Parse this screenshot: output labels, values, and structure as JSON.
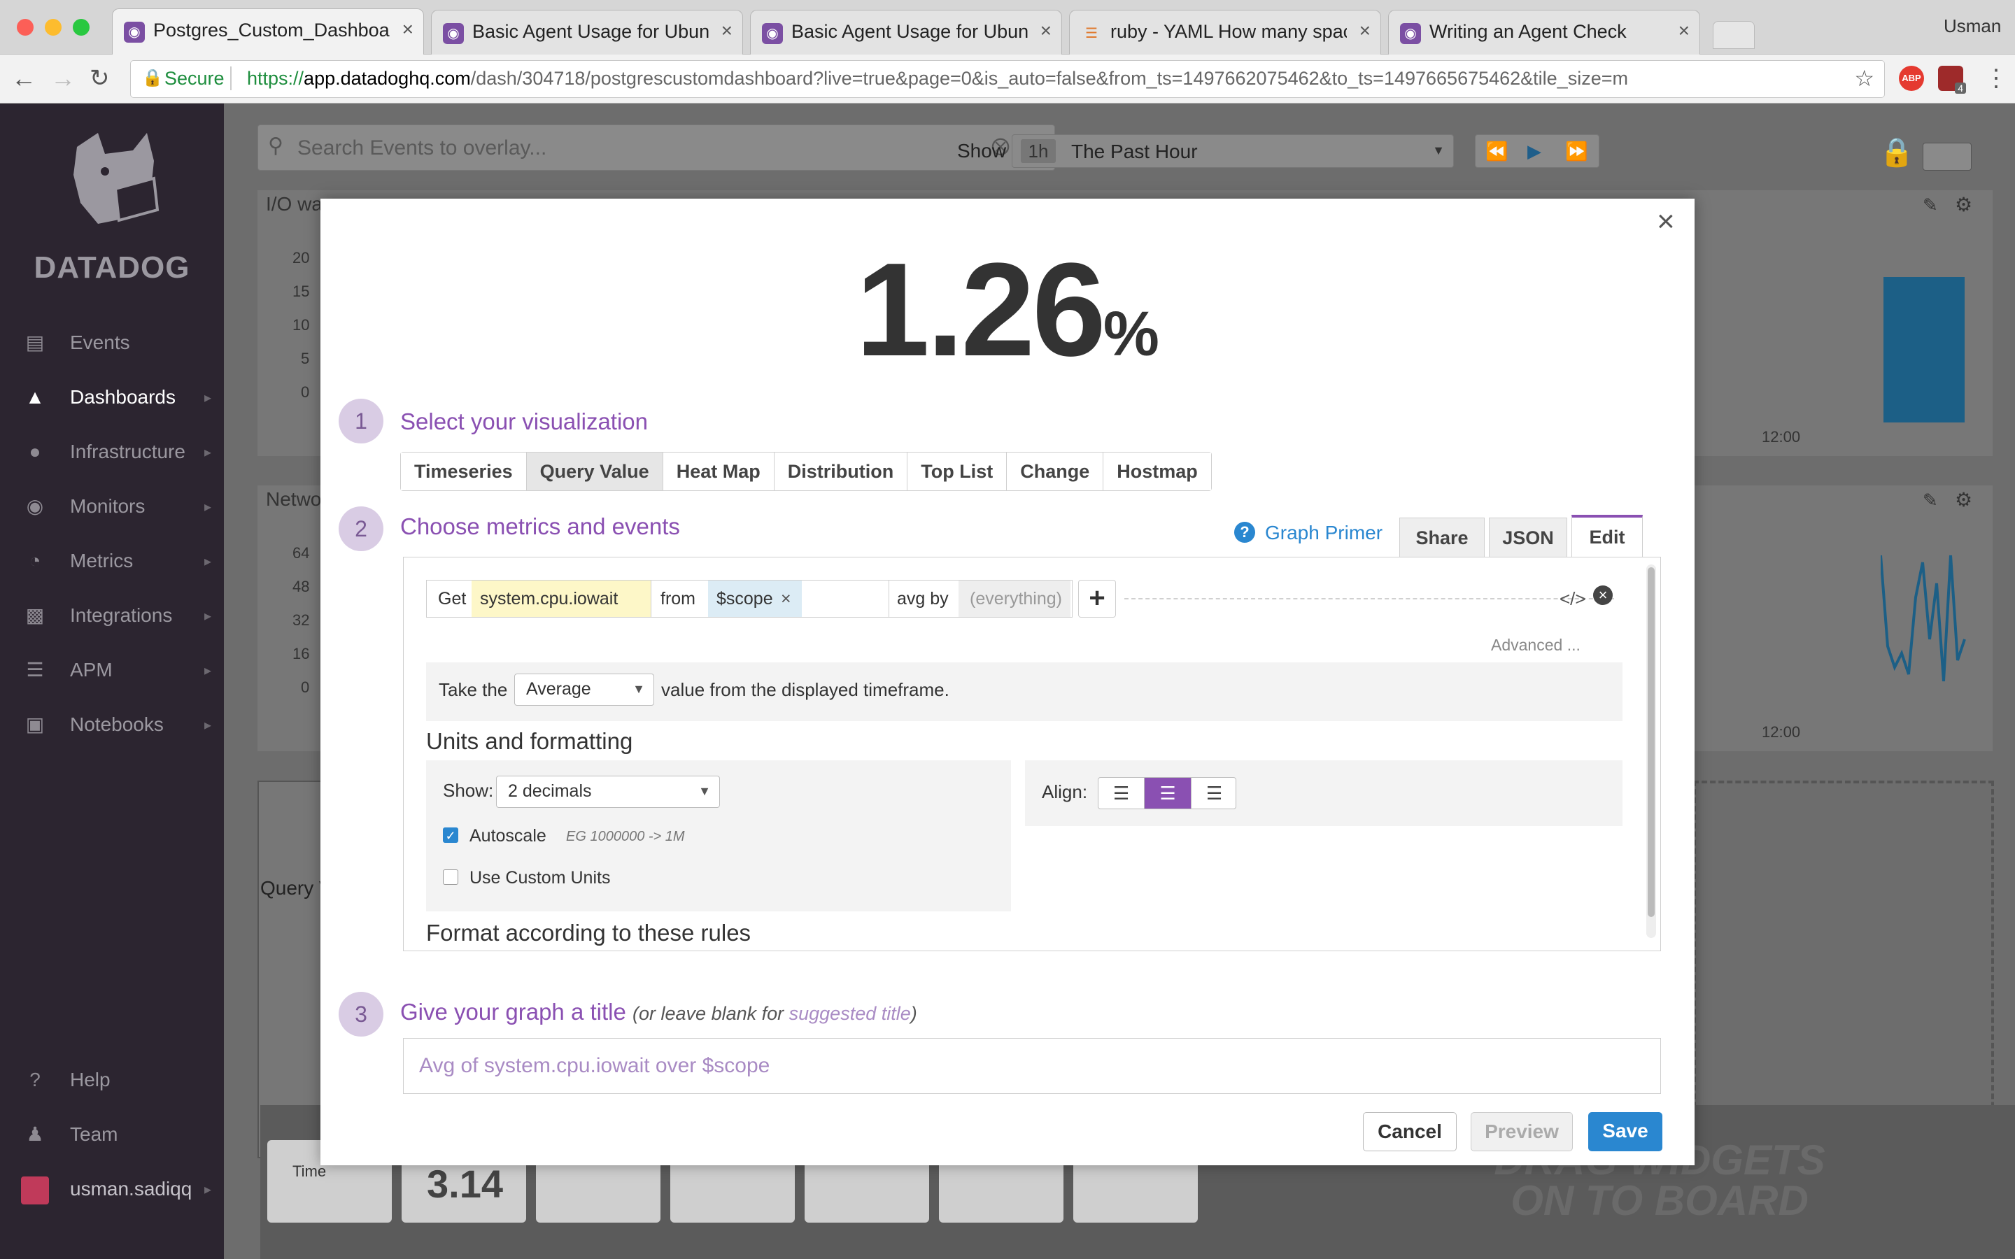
{
  "browser": {
    "tabs": [
      {
        "title": "Postgres_Custom_Dashboard | Da",
        "icon": "datadog-favicon"
      },
      {
        "title": "Basic Agent Usage for Ubuntu",
        "icon": "datadog-favicon"
      },
      {
        "title": "Basic Agent Usage for Ubuntu",
        "icon": "datadog-favicon"
      },
      {
        "title": "ruby - YAML How many spaces",
        "icon": "stackoverflow-favicon"
      },
      {
        "title": "Writing an Agent Check",
        "icon": "datadog-favicon"
      }
    ],
    "user": "Usman",
    "secure_label": "Secure",
    "url_scheme": "https://",
    "url_host": "app.datadoghq.com",
    "url_path": "/dash/304718/postgrescustomdashboard?live=true&page=0&is_auto=false&from_ts=1497662075462&to_ts=1497665675462&tile_size=m",
    "ext_badge": "4",
    "abp": "ABP"
  },
  "sidebar": {
    "logo_text": "DATADOG",
    "items": [
      {
        "label": "Events",
        "icon": "events-icon"
      },
      {
        "label": "Dashboards",
        "icon": "dashboards-icon"
      },
      {
        "label": "Infrastructure",
        "icon": "infrastructure-icon"
      },
      {
        "label": "Monitors",
        "icon": "monitors-icon"
      },
      {
        "label": "Metrics",
        "icon": "metrics-icon"
      },
      {
        "label": "Integrations",
        "icon": "integrations-icon"
      },
      {
        "label": "APM",
        "icon": "apm-icon"
      },
      {
        "label": "Notebooks",
        "icon": "notebooks-icon"
      }
    ],
    "bottom": [
      {
        "label": "Help",
        "icon": "help-icon"
      },
      {
        "label": "Team",
        "icon": "team-icon"
      },
      {
        "label": "usman.sadiqq",
        "icon": "avatar"
      }
    ]
  },
  "dashboard": {
    "search_placeholder": "Search Events to overlay...",
    "show_label": "Show",
    "time_short": "1h",
    "time_label": "The Past Hour",
    "graph1_title": "I/O wa",
    "graph2_title": "Netwo",
    "graph1_ticks": [
      "20",
      "15",
      "10",
      "5",
      "0"
    ],
    "graph2_ticks": [
      "64",
      "48",
      "32",
      "16",
      "0"
    ],
    "x_tick": "12:00",
    "query_widget_label": "Query V",
    "drag_text_1": "DRAG WIDGETS",
    "drag_text_2": "ON TO BOARD",
    "widget_tray_label": "Time",
    "widget_tray_value": "3.14"
  },
  "modal": {
    "big_value": "1.26",
    "big_unit": "%",
    "step1": {
      "num": "1",
      "title": "Select your visualization"
    },
    "viz_tabs": [
      "Timeseries",
      "Query Value",
      "Heat Map",
      "Distribution",
      "Top List",
      "Change",
      "Hostmap"
    ],
    "viz_selected": "Query Value",
    "step2": {
      "num": "2",
      "title": "Choose metrics and events"
    },
    "graph_primer": "Graph Primer",
    "right_tabs": [
      "Share",
      "JSON",
      "Edit"
    ],
    "query": {
      "get": "Get",
      "metric": "system.cpu.iowait",
      "from": "from",
      "scope": "$scope",
      "avg_by": "avg by",
      "everything": "(everything)",
      "advanced": "Advanced ..."
    },
    "aggregation": {
      "prefix": "Take the",
      "value": "Average",
      "suffix": "value from the displayed timeframe."
    },
    "units_title": "Units and formatting",
    "show_label": "Show:",
    "show_value": "2 decimals",
    "autoscale_label": "Autoscale",
    "autoscale_checked": true,
    "autoscale_hint": "EG 1000000 -> 1M",
    "custom_units_label": "Use Custom Units",
    "custom_units_checked": false,
    "align_label": "Align:",
    "align_selected": "center",
    "format_rules_title": "Format according to these rules",
    "step3": {
      "num": "3",
      "title": "Give your graph a title",
      "hint_prefix": "(or leave blank for ",
      "hint_link": "suggested title",
      "hint_suffix": ")"
    },
    "title_placeholder": "Avg of system.cpu.iowait over $scope",
    "buttons": {
      "cancel": "Cancel",
      "preview": "Preview",
      "save": "Save"
    }
  },
  "colors": {
    "accent_purple": "#8a50b2",
    "save_blue": "#2a87d0",
    "metric_highlight": "#fdf7c8",
    "scope_highlight": "#dcecf5",
    "sidebar_bg": "#2c2530"
  }
}
